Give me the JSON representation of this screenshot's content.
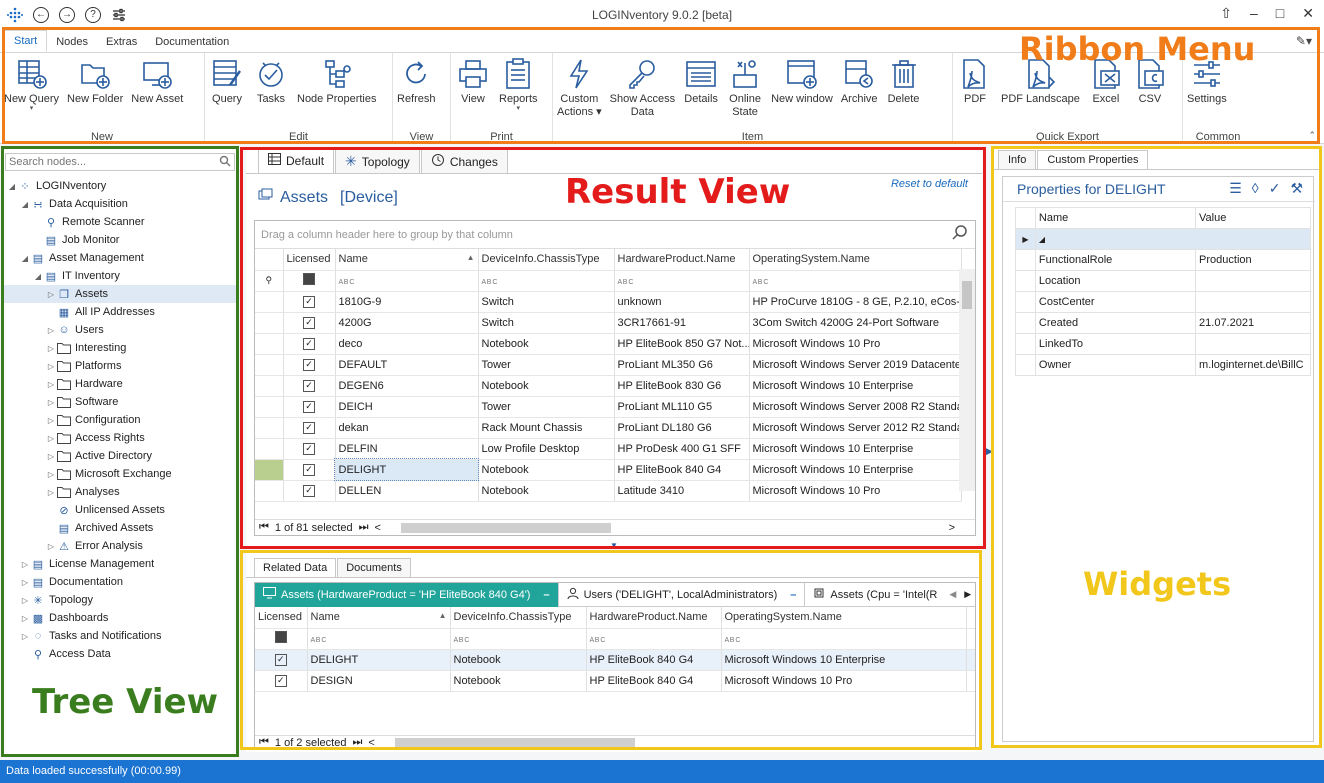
{
  "app": {
    "title": "LOGINventory 9.0.2 [beta]"
  },
  "ribbon": {
    "tabs": [
      "Start",
      "Nodes",
      "Extras",
      "Documentation"
    ],
    "groups": {
      "new": "New",
      "edit": "Edit",
      "view": "View",
      "print": "Print",
      "item": "Item",
      "quick_export": "Quick Export",
      "common": "Common"
    },
    "buttons": {
      "new_query": "New Query",
      "new_folder": "New Folder",
      "new_asset": "New Asset",
      "query": "Query",
      "tasks": "Tasks",
      "node_properties": "Node Properties",
      "refresh": "Refresh",
      "view": "View",
      "reports": "Reports",
      "custom_actions_1": "Custom",
      "custom_actions_2": "Actions",
      "show_access_1": "Show Access",
      "show_access_2": "Data",
      "details": "Details",
      "online_1": "Online",
      "online_2": "State",
      "new_window": "New window",
      "archive": "Archive",
      "delete": "Delete",
      "pdf": "PDF",
      "pdf_landscape": "PDF Landscape",
      "excel": "Excel",
      "csv": "CSV",
      "settings": "Settings"
    }
  },
  "annotations": {
    "ribbon_menu": "Ribbon Menu",
    "result_view": "Result View",
    "tree_view": "Tree View",
    "widgets": "Widgets",
    "colors": {
      "orange": "#f07d1a",
      "red": "#e31b1b",
      "green": "#3a7d1e",
      "yellow": "#f2c71c"
    }
  },
  "tree": {
    "search_placeholder": "Search nodes...",
    "nodes": [
      {
        "label": "LOGINventory",
        "level": 0,
        "expanded": true,
        "icon": "logo-icon"
      },
      {
        "label": "Data Acquisition",
        "level": 1,
        "expanded": true,
        "icon": "antenna-icon"
      },
      {
        "label": "Remote Scanner",
        "level": 2,
        "icon": "search-icon"
      },
      {
        "label": "Job Monitor",
        "level": 2,
        "icon": "monitor-icon"
      },
      {
        "label": "Asset Management",
        "level": 1,
        "expanded": true,
        "icon": "hierarchy-icon"
      },
      {
        "label": "IT Inventory",
        "level": 2,
        "expanded": true,
        "icon": "computer-icon"
      },
      {
        "label": "Assets",
        "level": 3,
        "collapsed": true,
        "icon": "assets-icon",
        "selected": true
      },
      {
        "label": "All IP Addresses",
        "level": 3,
        "icon": "table-icon"
      },
      {
        "label": "Users",
        "level": 3,
        "collapsed": true,
        "icon": "user-icon"
      },
      {
        "label": "Interesting",
        "level": 3,
        "collapsed": true,
        "icon": "folder-icon"
      },
      {
        "label": "Platforms",
        "level": 3,
        "collapsed": true,
        "icon": "folder-icon"
      },
      {
        "label": "Hardware",
        "level": 3,
        "collapsed": true,
        "icon": "folder-icon"
      },
      {
        "label": "Software",
        "level": 3,
        "collapsed": true,
        "icon": "folder-icon"
      },
      {
        "label": "Configuration",
        "level": 3,
        "collapsed": true,
        "icon": "folder-icon"
      },
      {
        "label": "Access Rights",
        "level": 3,
        "collapsed": true,
        "icon": "folder-icon"
      },
      {
        "label": "Active Directory",
        "level": 3,
        "collapsed": true,
        "icon": "folder-icon"
      },
      {
        "label": "Microsoft Exchange",
        "level": 3,
        "collapsed": true,
        "icon": "folder-icon"
      },
      {
        "label": "Analyses",
        "level": 3,
        "collapsed": true,
        "icon": "folder-icon"
      },
      {
        "label": "Unlicensed Assets",
        "level": 3,
        "icon": "blocked-icon"
      },
      {
        "label": "Archived Assets",
        "level": 3,
        "icon": "archive-icon"
      },
      {
        "label": "Error Analysis",
        "level": 3,
        "collapsed": true,
        "icon": "warning-icon"
      },
      {
        "label": "License Management",
        "level": 1,
        "collapsed": true,
        "icon": "license-icon"
      },
      {
        "label": "Documentation",
        "level": 1,
        "collapsed": true,
        "icon": "document-icon"
      },
      {
        "label": "Topology",
        "level": 1,
        "collapsed": true,
        "icon": "topology-icon"
      },
      {
        "label": "Dashboards",
        "level": 1,
        "collapsed": true,
        "icon": "chart-icon"
      },
      {
        "label": "Tasks and Notifications",
        "level": 1,
        "collapsed": true,
        "icon": "tasks-icon"
      },
      {
        "label": "Access Data",
        "level": 1,
        "icon": "key-icon"
      }
    ]
  },
  "result": {
    "tabs": [
      "Default",
      "Topology",
      "Changes"
    ],
    "title": "Assets",
    "subtitle": "[Device]",
    "reset": "Reset to default",
    "group_hint": "Drag a column header here to group by that column",
    "columns": [
      "Licensed",
      "Name",
      "DeviceInfo.ChassisType",
      "HardwareProduct.Name",
      "OperatingSystem.Name"
    ],
    "rows": [
      [
        "1810G-9",
        "Switch",
        "unknown",
        "HP ProCurve 1810G - 8 GE, P.2.10, eCos-2"
      ],
      [
        "4200G",
        "Switch",
        "3CR17661-91",
        "3Com Switch 4200G 24-Port Software"
      ],
      [
        "deco",
        "Notebook",
        "HP EliteBook 850 G7 Not...",
        "Microsoft Windows 10 Pro"
      ],
      [
        "DEFAULT",
        "Tower",
        "ProLiant ML350 G6",
        "Microsoft Windows Server 2019 Datacente"
      ],
      [
        "DEGEN6",
        "Notebook",
        "HP EliteBook 830 G6",
        "Microsoft Windows 10 Enterprise"
      ],
      [
        "DEICH",
        "Tower",
        "ProLiant ML110 G5",
        "Microsoft Windows Server 2008 R2 Standa"
      ],
      [
        "dekan",
        "Rack Mount Chassis",
        "ProLiant DL180 G6",
        "Microsoft Windows Server 2012 R2 Standa"
      ],
      [
        "DELFIN",
        "Low Profile Desktop",
        "HP ProDesk 400 G1 SFF",
        "Microsoft Windows 10 Enterprise"
      ],
      [
        "DELIGHT",
        "Notebook",
        "HP EliteBook 840 G4",
        "Microsoft Windows 10 Enterprise"
      ],
      [
        "DELLEN",
        "Notebook",
        "Latitude 3410",
        "Microsoft Windows 10 Pro"
      ]
    ],
    "footer": "1 of 81 selected"
  },
  "related": {
    "tabs": [
      "Related Data",
      "Documents"
    ],
    "subtabs": [
      "Assets (HardwareProduct = 'HP EliteBook 840 G4')",
      "Users ('DELIGHT', LocalAdministrators)",
      "Assets (Cpu = 'Intel(R"
    ],
    "columns": [
      "Licensed",
      "Name",
      "DeviceInfo.ChassisType",
      "HardwareProduct.Name",
      "OperatingSystem.Name"
    ],
    "rows": [
      [
        "DELIGHT",
        "Notebook",
        "HP EliteBook 840 G4",
        "Microsoft Windows 10 Enterprise"
      ],
      [
        "DESIGN",
        "Notebook",
        "HP EliteBook 840 G4",
        "Microsoft Windows 10 Pro"
      ]
    ],
    "footer": "1 of 2 selected"
  },
  "widgets": {
    "tabs": [
      "Info",
      "Custom Properties"
    ],
    "title": "Properties for DELIGHT",
    "columns": [
      "Name",
      "Value"
    ],
    "props": [
      [
        "FunctionalRole",
        "Production"
      ],
      [
        "Location",
        ""
      ],
      [
        "CostCenter",
        ""
      ],
      [
        "Created",
        "21.07.2021"
      ],
      [
        "LinkedTo",
        ""
      ],
      [
        "Owner",
        "m.loginternet.de\\BillC"
      ]
    ]
  },
  "status": {
    "text": "Data loaded successfully (00:00.99)"
  }
}
